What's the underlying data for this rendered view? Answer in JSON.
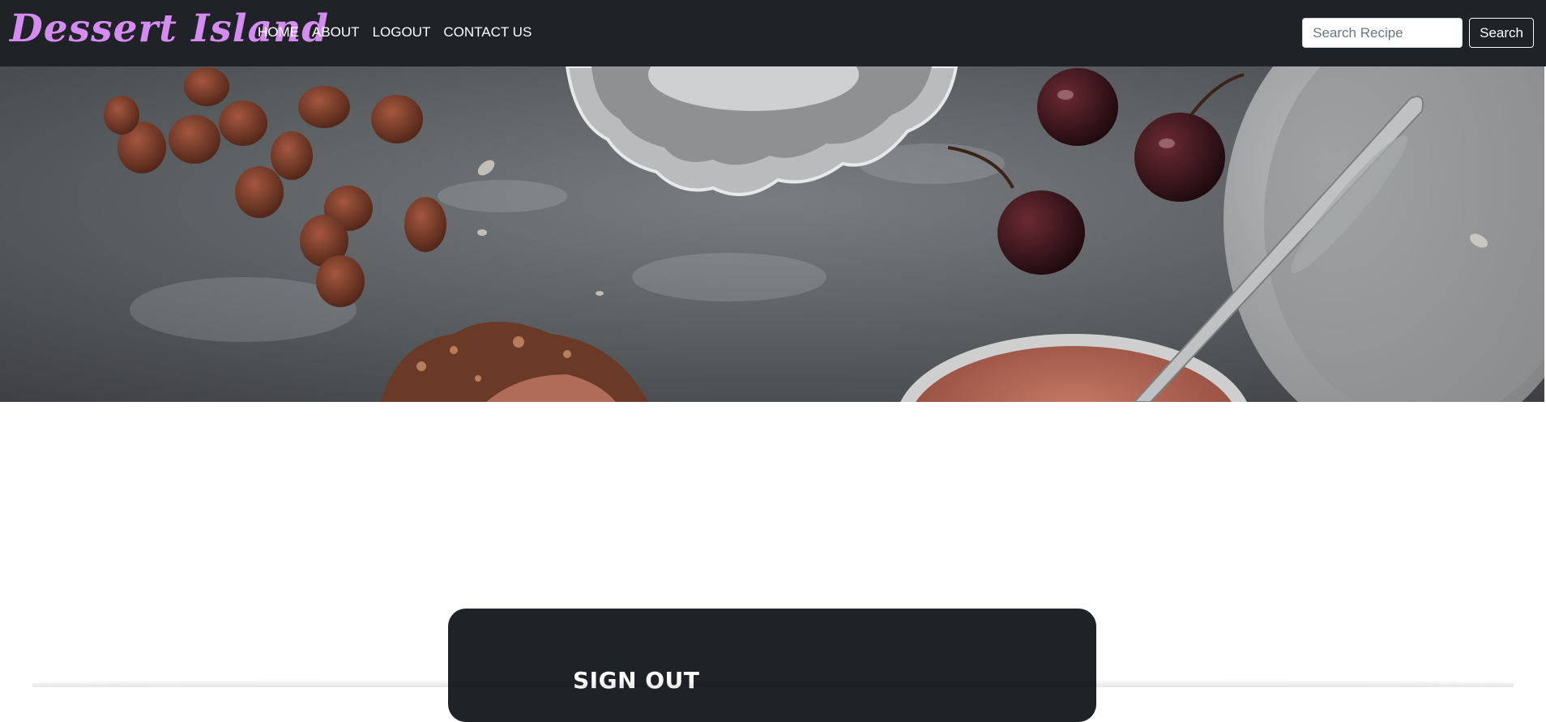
{
  "brand": {
    "name": "Dessert Island",
    "color": "#d58cf0"
  },
  "nav": {
    "items": [
      {
        "label": "HOME"
      },
      {
        "label": "ABOUT"
      },
      {
        "label": "LOGOUT"
      },
      {
        "label": "CONTACT US"
      }
    ]
  },
  "search": {
    "placeholder": "Search Recipe",
    "value": "",
    "button_label": "Search"
  },
  "hero": {
    "description_icon": "dessert-photo"
  },
  "card": {
    "title": "SIGN OUT"
  },
  "colors": {
    "navbar_bg": "#1f2226",
    "card_bg": "#1f2226",
    "page_bg": "#ffffff"
  }
}
